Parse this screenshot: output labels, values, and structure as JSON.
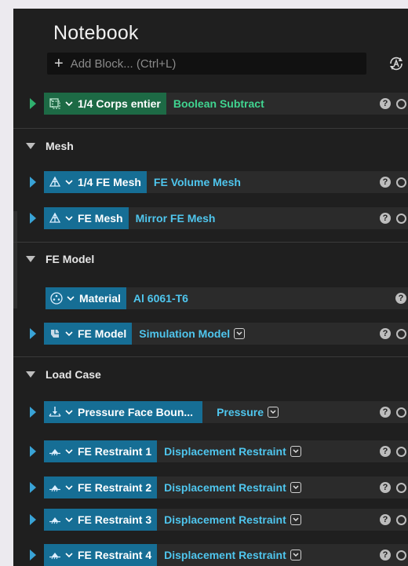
{
  "notebook": {
    "title": "Notebook",
    "add_block_placeholder": "Add Block... (Ctrl+L)",
    "add_icon": "plus-icon",
    "auto_icon": "auto-run-icon"
  },
  "top_block": {
    "name": "1/4 Corps entier",
    "type": "Boolean Subtract",
    "icon": "boolean-body-icon",
    "accent": "#1d6a45",
    "type_color": "#40d490"
  },
  "sections": [
    {
      "label": "Mesh",
      "blocks": [
        {
          "name": "1/4 FE Mesh",
          "type": "FE Volume Mesh",
          "icon": "mesh-icon",
          "dropdown": false
        },
        {
          "name": "FE Mesh",
          "type": "Mirror FE Mesh",
          "icon": "mesh-icon",
          "dropdown": false
        }
      ]
    },
    {
      "label": "FE Model",
      "blocks": [
        {
          "name": "Material",
          "type": "Al 6061-T6",
          "icon": "material-icon",
          "dropdown": false
        },
        {
          "name": "FE Model",
          "type": "Simulation Model",
          "icon": "fe-model-icon",
          "dropdown": true
        }
      ]
    },
    {
      "label": "Load Case",
      "blocks": [
        {
          "name": "Pressure Face Boun...",
          "type": "Pressure",
          "icon": "pressure-icon",
          "dropdown": true
        },
        {
          "name": "FE Restraint 1",
          "type": "Displacement Restraint",
          "icon": "restraint-icon",
          "dropdown": true
        },
        {
          "name": "FE Restraint 2",
          "type": "Displacement Restraint",
          "icon": "restraint-icon",
          "dropdown": true
        },
        {
          "name": "FE Restraint 3",
          "type": "Displacement Restraint",
          "icon": "restraint-icon",
          "dropdown": true
        },
        {
          "name": "FE Restraint 4",
          "type": "Displacement Restraint",
          "icon": "restraint-icon",
          "dropdown": true
        }
      ]
    }
  ],
  "help_symbol": "?",
  "colors": {
    "panel_bg": "#1f1f1f",
    "block_accent": "#166e95",
    "block_type_text": "#4fc6ee",
    "expand_arrow": "#39a3d6"
  }
}
